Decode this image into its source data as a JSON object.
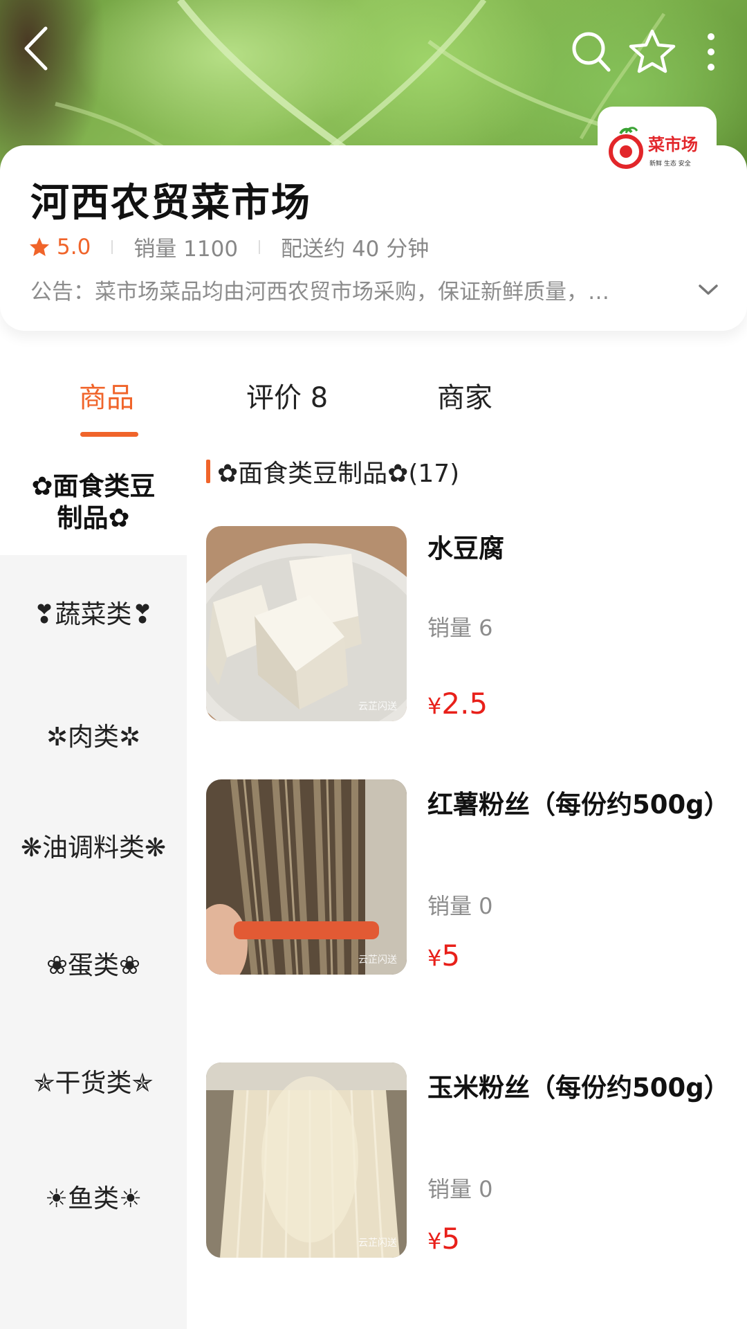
{
  "store": {
    "name": "河西农贸菜市场",
    "rating": "5.0",
    "sales": "销量 1100",
    "delivery": "配送约 40 分钟",
    "notice_label": "公告：",
    "notice_text": "菜市场菜品均由河西农贸市场采购，保证新鲜质量，…",
    "logo_text": "菜市场",
    "logo_sub": "新鲜  生态  安全"
  },
  "icons": {
    "back": "back-arrow-icon",
    "search": "search-icon",
    "favorite": "star-outline-icon",
    "more": "more-vertical-icon",
    "expand": "chevron-down-icon"
  },
  "tabs": [
    {
      "label": "商品",
      "active": true
    },
    {
      "label": "评价 8",
      "active": false
    },
    {
      "label": "商家",
      "active": false
    }
  ],
  "categories": [
    {
      "label": "✿面食类豆制品✿",
      "active": true
    },
    {
      "label": "❣蔬菜类❣",
      "active": false
    },
    {
      "label": "✲肉类✲",
      "active": false
    },
    {
      "label": "❋油调料类❋",
      "active": false
    },
    {
      "label": "❀蛋类❀",
      "active": false
    },
    {
      "label": "✯干货类✯",
      "active": false
    },
    {
      "label": "☀鱼类☀",
      "active": false
    }
  ],
  "section": {
    "title": "✿面食类豆制品✿(17)"
  },
  "products": [
    {
      "name": "水豆腐",
      "sales": "销量 6",
      "currency": "¥",
      "price": "2.5",
      "image": "tofu-photo"
    },
    {
      "name": "红薯粉丝（每份约500g）",
      "sales": "销量 0",
      "currency": "¥",
      "price": "5",
      "image": "sweet-potato-noodles-photo"
    },
    {
      "name": "玉米粉丝（每份约500g）",
      "sales": "销量 0",
      "currency": "¥",
      "price": "5",
      "image": "corn-noodles-photo"
    }
  ],
  "colors": {
    "accent": "#f0642a",
    "price": "#e8201a",
    "rail_bg": "#f5f5f5"
  }
}
